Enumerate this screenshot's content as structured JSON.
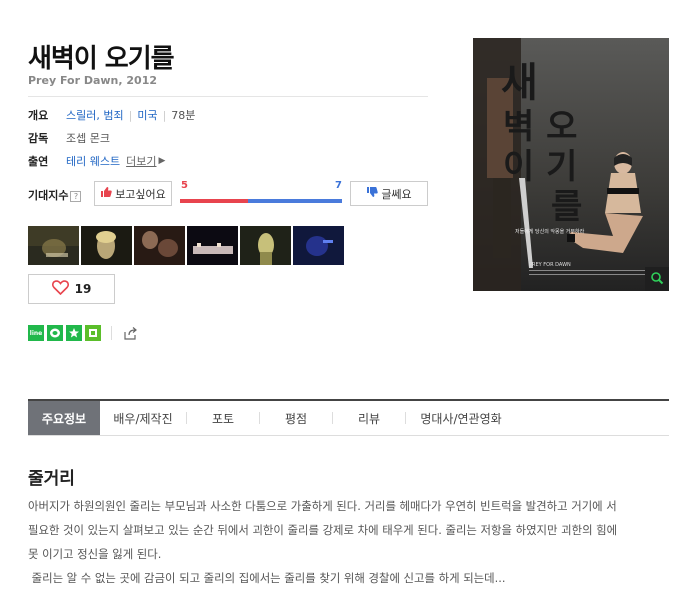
{
  "movie": {
    "title": "새벽이 오기를",
    "subtitle": "Prey For Dawn, 2012"
  },
  "info": {
    "overview": {
      "label": "개요",
      "genre": "스릴러, 범죄",
      "country": "미국",
      "runtime": "78분"
    },
    "director": {
      "label": "감독",
      "name": "조셉 몬크"
    },
    "cast": {
      "label": "출연",
      "name": "테리 웨스트",
      "more": "더보기"
    }
  },
  "expectation": {
    "label": "기대지수",
    "help_icon": "question-icon",
    "like_label": "보고싶어요",
    "dislike_label": "글쎄요",
    "like_count": "5",
    "dislike_count": "7",
    "like_fraction": 0.417,
    "colors": {
      "like": "#e8444e",
      "dislike": "#4a7bdc"
    }
  },
  "stills": [
    "still-1",
    "still-2",
    "still-3",
    "still-4",
    "still-5",
    "still-6"
  ],
  "like_button": {
    "icon": "heart-icon",
    "count": "19"
  },
  "share": {
    "icons": [
      "line-icon",
      "kakao-icon",
      "band-star-icon",
      "story-icon",
      "share-icon"
    ],
    "line_text": "line"
  },
  "poster": {
    "title_text": "새벽이 오기를",
    "tagline": "저들에게 당신의 악몽을 거부하라",
    "zoom_icon": "magnifier-icon"
  },
  "tabs": [
    {
      "label": "주요정보",
      "active": true
    },
    {
      "label": "배우/제작진",
      "active": false
    },
    {
      "label": "포토",
      "active": false
    },
    {
      "label": "평점",
      "active": false
    },
    {
      "label": "리뷰",
      "active": false
    },
    {
      "label": "명대사/연관영화",
      "active": false
    }
  ],
  "synopsis": {
    "title": "줄거리",
    "lines": [
      "아버지가 하원의원인 줄리는 부모님과 사소한 다툼으로 가출하게 된다. 거리를 헤매다가 우연히 빈트럭을 발견하고 거기에 서",
      "필요한 것이 있는지 살펴보고 있는 순간 뒤에서 괴한이 줄리를 강제로 차에 태우게 된다. 줄리는 저항을 하였지만 괴한의 힘에",
      "못 이기고 정신을 잃게 된다.",
      " 줄리는 알 수 없는 곳에 감금이 되고 줄리의 집에서는 줄리를 찾기 위해 경찰에 신고를 하게 되는데..."
    ]
  }
}
